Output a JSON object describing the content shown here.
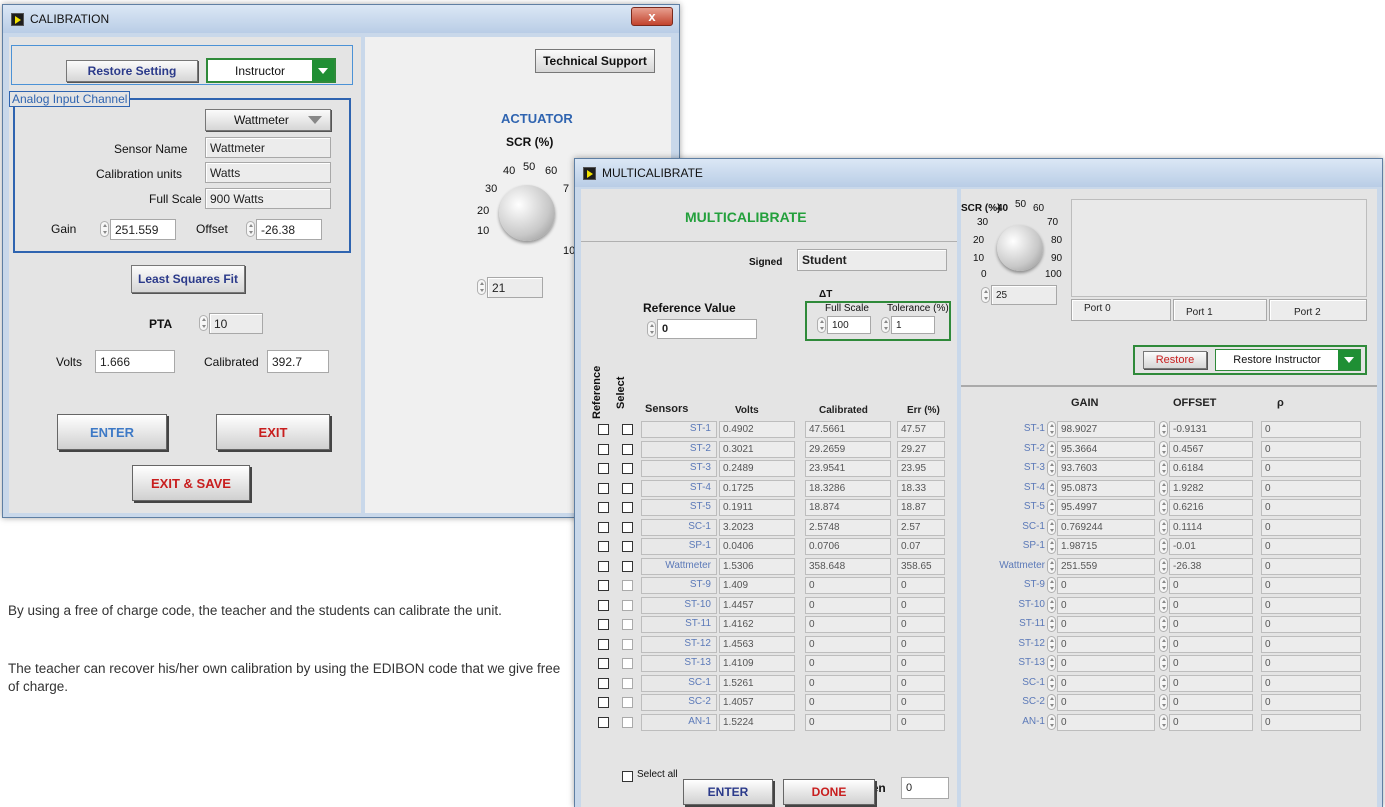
{
  "calibration": {
    "title": "CALIBRATION",
    "close": "x",
    "restore_setting": "Restore Setting",
    "user_select": "Instructor",
    "technical_support": "Technical Support",
    "analog_group": "Analog Input Channel",
    "channel_select": "Wattmeter",
    "sensor_name_label": "Sensor Name",
    "sensor_name": "Wattmeter",
    "cal_units_label": "Calibration units",
    "cal_units": "Watts",
    "full_scale_label": "Full Scale",
    "full_scale": "900 Watts",
    "gain_label": "Gain",
    "gain": "251.559",
    "offset_label": "Offset",
    "offset": "-26.38",
    "lsq": "Least Squares Fit",
    "pta_label": "PTA",
    "pta": "10",
    "volts_label": "Volts",
    "volts": "1.666",
    "calibrated_label": "Calibrated",
    "calibrated": "392.7",
    "enter": "ENTER",
    "exit": "EXIT",
    "exit_save": "EXIT & SAVE",
    "actuator": "ACTUATOR",
    "scr": "SCR (%)",
    "knob_ticks": [
      "10",
      "20",
      "30",
      "40",
      "50",
      "60",
      "7",
      "10"
    ],
    "scr_value": "21"
  },
  "multi": {
    "title": "MULTICALIBRATE",
    "heading": "MULTICALIBRATE",
    "signed_label": "Signed",
    "signed": "Student",
    "ref_value_label": "Reference Value",
    "ref_value": "0",
    "delta_t": "ΔT",
    "full_scale_label": "Full Scale",
    "full_scale": "100",
    "tolerance_label": "Tolerance (%)",
    "tolerance": "1",
    "col_reference": "Reference",
    "col_select": "Select",
    "col_sensors": "Sensors",
    "col_volts": "Volts",
    "col_calibrated": "Calibrated",
    "col_err": "Err (%)",
    "rows": [
      {
        "name": "ST-1",
        "volts": "0.4902",
        "cal": "47.5661",
        "err": "47.57"
      },
      {
        "name": "ST-2",
        "volts": "0.3021",
        "cal": "29.2659",
        "err": "29.27"
      },
      {
        "name": "ST-3",
        "volts": "0.2489",
        "cal": "23.9541",
        "err": "23.95"
      },
      {
        "name": "ST-4",
        "volts": "0.1725",
        "cal": "18.3286",
        "err": "18.33"
      },
      {
        "name": "ST-5",
        "volts": "0.1911",
        "cal": "18.874",
        "err": "18.87"
      },
      {
        "name": "SC-1",
        "volts": "3.2023",
        "cal": "2.5748",
        "err": "2.57"
      },
      {
        "name": "SP-1",
        "volts": "0.0406",
        "cal": "0.0706",
        "err": "0.07"
      },
      {
        "name": "Wattmeter",
        "volts": "1.5306",
        "cal": "358.648",
        "err": "358.65"
      },
      {
        "name": "ST-9",
        "volts": "1.409",
        "cal": "0",
        "err": "0"
      },
      {
        "name": "ST-10",
        "volts": "1.4457",
        "cal": "0",
        "err": "0"
      },
      {
        "name": "ST-11",
        "volts": "1.4162",
        "cal": "0",
        "err": "0"
      },
      {
        "name": "ST-12",
        "volts": "1.4563",
        "cal": "0",
        "err": "0"
      },
      {
        "name": "ST-13",
        "volts": "1.4109",
        "cal": "0",
        "err": "0"
      },
      {
        "name": "SC-1",
        "volts": "1.5261",
        "cal": "0",
        "err": "0"
      },
      {
        "name": "SC-2",
        "volts": "1.4057",
        "cal": "0",
        "err": "0"
      },
      {
        "name": "AN-1",
        "volts": "1.5224",
        "cal": "0",
        "err": "0"
      }
    ],
    "select_all": "Select all",
    "data_taken_label": "Data taken",
    "data_taken": "0",
    "enter": "ENTER",
    "done": "DONE",
    "scr": "SCR (%)",
    "knob_ticks": [
      "0",
      "10",
      "20",
      "30",
      "40",
      "50",
      "60",
      "70",
      "80",
      "90",
      "100"
    ],
    "scr_value": "25",
    "port0": "Port 0",
    "port1": "Port 1",
    "port2": "Port 2",
    "restore": "Restore",
    "restore_instructor": "Restore Instructor",
    "col_gain": "GAIN",
    "col_offset": "OFFSET",
    "col_rho": "ρ",
    "gains": [
      {
        "name": "ST-1",
        "gain": "98.9027",
        "offset": "-0.9131",
        "rho": "0"
      },
      {
        "name": "ST-2",
        "gain": "95.3664",
        "offset": "0.4567",
        "rho": "0"
      },
      {
        "name": "ST-3",
        "gain": "93.7603",
        "offset": "0.6184",
        "rho": "0"
      },
      {
        "name": "ST-4",
        "gain": "95.0873",
        "offset": "1.9282",
        "rho": "0"
      },
      {
        "name": "ST-5",
        "gain": "95.4997",
        "offset": "0.6216",
        "rho": "0"
      },
      {
        "name": "SC-1",
        "gain": "0.769244",
        "offset": "0.1114",
        "rho": "0"
      },
      {
        "name": "SP-1",
        "gain": "1.98715",
        "offset": "-0.01",
        "rho": "0"
      },
      {
        "name": "Wattmeter",
        "gain": "251.559",
        "offset": "-26.38",
        "rho": "0"
      },
      {
        "name": "ST-9",
        "gain": "0",
        "offset": "0",
        "rho": "0"
      },
      {
        "name": "ST-10",
        "gain": "0",
        "offset": "0",
        "rho": "0"
      },
      {
        "name": "ST-11",
        "gain": "0",
        "offset": "0",
        "rho": "0"
      },
      {
        "name": "ST-12",
        "gain": "0",
        "offset": "0",
        "rho": "0"
      },
      {
        "name": "ST-13",
        "gain": "0",
        "offset": "0",
        "rho": "0"
      },
      {
        "name": "SC-1",
        "gain": "0",
        "offset": "0",
        "rho": "0"
      },
      {
        "name": "SC-2",
        "gain": "0",
        "offset": "0",
        "rho": "0"
      },
      {
        "name": "AN-1",
        "gain": "0",
        "offset": "0",
        "rho": "0"
      }
    ]
  },
  "caption": {
    "p1": "By using a free of charge code, the teacher and the students can calibrate the unit.",
    "p2": "The teacher can recover his/her own calibration by using the EDIBON code that we give free of charge."
  },
  "colors": {
    "green_accent": "#1f8f34",
    "blue_border": "#2f64b0",
    "red_text": "#c81e1e",
    "title_green": "#23a03c"
  }
}
